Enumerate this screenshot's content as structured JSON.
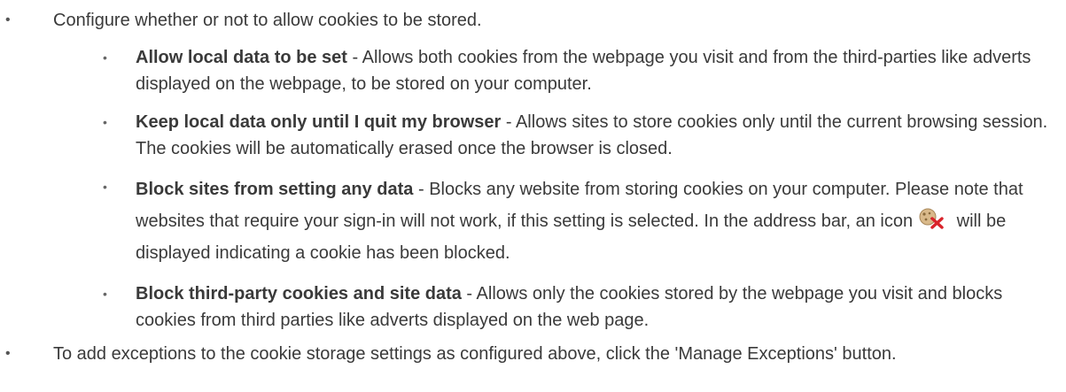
{
  "intro": "Configure whether or not to allow cookies to be stored.",
  "options": [
    {
      "term": "Allow local data to be set",
      "text": " - Allows both cookies from the webpage you visit and from the third-parties like adverts displayed on the webpage, to be stored on your computer."
    },
    {
      "term": "Keep local data only until I quit my browser",
      "text": " - Allows sites to store cookies only until the current browsing session. The cookies will be automatically erased once the browser is closed."
    },
    {
      "term": "Block sites from setting any data",
      "text": " - Blocks any website from storing cookies on your computer. Please note that websites that require your sign-in will not work, if this setting is selected. In the address bar, an icon",
      "text_after_icon": " will be displayed indicating a cookie has been blocked.",
      "icon": "cookie-blocked-icon"
    },
    {
      "term": "Block third-party cookies and site data",
      "text": " - Allows only the cookies stored by the webpage you visit and blocks cookies from third parties like adverts displayed on the web page."
    }
  ],
  "outro": "To add exceptions to the cookie storage settings as configured above, click the 'Manage Exceptions' button.",
  "colors": {
    "text": "#3a3a3a",
    "cookie": "#d9b98a",
    "blocked_x": "#d9232a"
  }
}
